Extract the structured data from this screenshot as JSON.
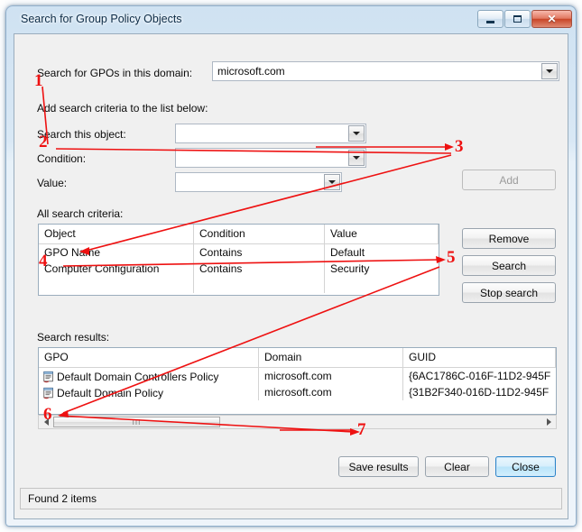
{
  "window": {
    "title": "Search for Group Policy Objects",
    "controls": {
      "minimize": "Minimize",
      "maximize": "Maximize",
      "close": "✕"
    }
  },
  "domain_row": {
    "label": "Search for GPOs in this domain:",
    "value": "microsoft.com",
    "placeholder": ""
  },
  "criteria_section": {
    "heading": "Add search criteria to the list below:",
    "fields": [
      {
        "label": "Search this object:",
        "value": "",
        "placeholder": ""
      },
      {
        "label": "Condition:",
        "value": "",
        "placeholder": ""
      },
      {
        "label": "Value:",
        "value": "",
        "placeholder": ""
      }
    ],
    "add_button": "Add"
  },
  "criteria_list": {
    "label": "All search criteria:",
    "columns": [
      "Object",
      "Condition",
      "Value"
    ],
    "rows": [
      {
        "object": "GPO Name",
        "condition": "Contains",
        "value": "Default"
      },
      {
        "object": "Computer Configuration",
        "condition": "Contains",
        "value": "Security"
      }
    ],
    "buttons": {
      "remove": "Remove",
      "search": "Search",
      "stop": "Stop search"
    }
  },
  "results": {
    "label": "Search results:",
    "columns": [
      "GPO",
      "Domain",
      "GUID"
    ],
    "rows": [
      {
        "icon": "gpo-scroll-icon",
        "gpo": "Default Domain Controllers Policy",
        "domain": "microsoft.com",
        "guid": "{6AC1786C-016F-11D2-945F"
      },
      {
        "icon": "gpo-scroll-icon",
        "gpo": "Default Domain Policy",
        "domain": "microsoft.com",
        "guid": "{31B2F340-016D-11D2-945F"
      }
    ],
    "scrollbar": {
      "left_arrow": "◀",
      "right_arrow": "▶",
      "grip": "III"
    }
  },
  "footer": {
    "save_results": "Save results",
    "clear": "Clear",
    "close": "Close"
  },
  "statusbar": {
    "text": "Found 2 items"
  },
  "annotations": [
    {
      "id": "1",
      "text": "1"
    },
    {
      "id": "2",
      "text": "2"
    },
    {
      "id": "3",
      "text": "3"
    },
    {
      "id": "4",
      "text": "4"
    },
    {
      "id": "5",
      "text": "5"
    },
    {
      "id": "6",
      "text": "6"
    },
    {
      "id": "7",
      "text": "7"
    }
  ],
  "colors": {
    "annotation": "#ee1111",
    "title_text": "#0c2b46",
    "dialog_bg": "#f0f0f0",
    "close_button": "#c84527",
    "default_button_border": "#2c85c9"
  }
}
